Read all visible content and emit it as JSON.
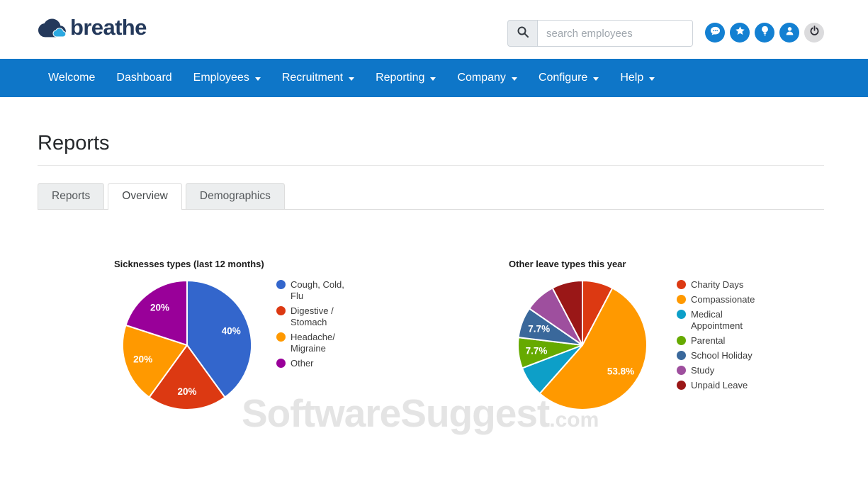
{
  "header": {
    "logo_text": "breathe",
    "search": {
      "placeholder": "search employees"
    },
    "icons": [
      {
        "name": "chat"
      },
      {
        "name": "star"
      },
      {
        "name": "lightbulb"
      },
      {
        "name": "user"
      },
      {
        "name": "power"
      }
    ]
  },
  "nav": {
    "items": [
      {
        "label": "Welcome",
        "dropdown": false
      },
      {
        "label": "Dashboard",
        "dropdown": false
      },
      {
        "label": "Employees",
        "dropdown": true
      },
      {
        "label": "Recruitment",
        "dropdown": true
      },
      {
        "label": "Reporting",
        "dropdown": true
      },
      {
        "label": "Company",
        "dropdown": true
      },
      {
        "label": "Configure",
        "dropdown": true
      },
      {
        "label": "Help",
        "dropdown": true
      }
    ]
  },
  "page": {
    "title": "Reports"
  },
  "tabs": [
    {
      "label": "Reports",
      "active": false
    },
    {
      "label": "Overview",
      "active": true
    },
    {
      "label": "Demographics",
      "active": false
    }
  ],
  "watermark": {
    "main": "SoftwareSuggest",
    "suffix": ".com"
  },
  "chart_data": [
    {
      "type": "pie",
      "title": "Sicknesses types (last 12 months)",
      "categories": [
        "Cough, Cold, Flu",
        "Digestive / Stomach",
        "Headache/ Migraine",
        "Other"
      ],
      "values": [
        40,
        20,
        20,
        20
      ],
      "slice_labels": [
        "40%",
        "20%",
        "20%",
        "20%"
      ],
      "colors": [
        "#3366CC",
        "#DC3912",
        "#FF9900",
        "#990099"
      ],
      "legend_position": "right",
      "start_angle_deg": 0,
      "direction": "clockwise"
    },
    {
      "type": "pie",
      "title": "Other leave types this year",
      "categories": [
        "Charity Days",
        "Compassionate",
        "Medical Appointment",
        "Parental",
        "School Holiday",
        "Study",
        "Unpaid Leave"
      ],
      "values": [
        7.7,
        53.8,
        7.7,
        7.7,
        7.7,
        7.7,
        7.7
      ],
      "slice_labels": [
        "",
        "53.8%",
        "",
        "7.7%",
        "7.7%",
        "",
        ""
      ],
      "colors": [
        "#DC3912",
        "#FF9900",
        "#0D9FC8",
        "#66AA00",
        "#3A689B",
        "#9E4F9E",
        "#9A1717"
      ],
      "legend_position": "right",
      "start_angle_deg": 0,
      "direction": "clockwise"
    }
  ]
}
